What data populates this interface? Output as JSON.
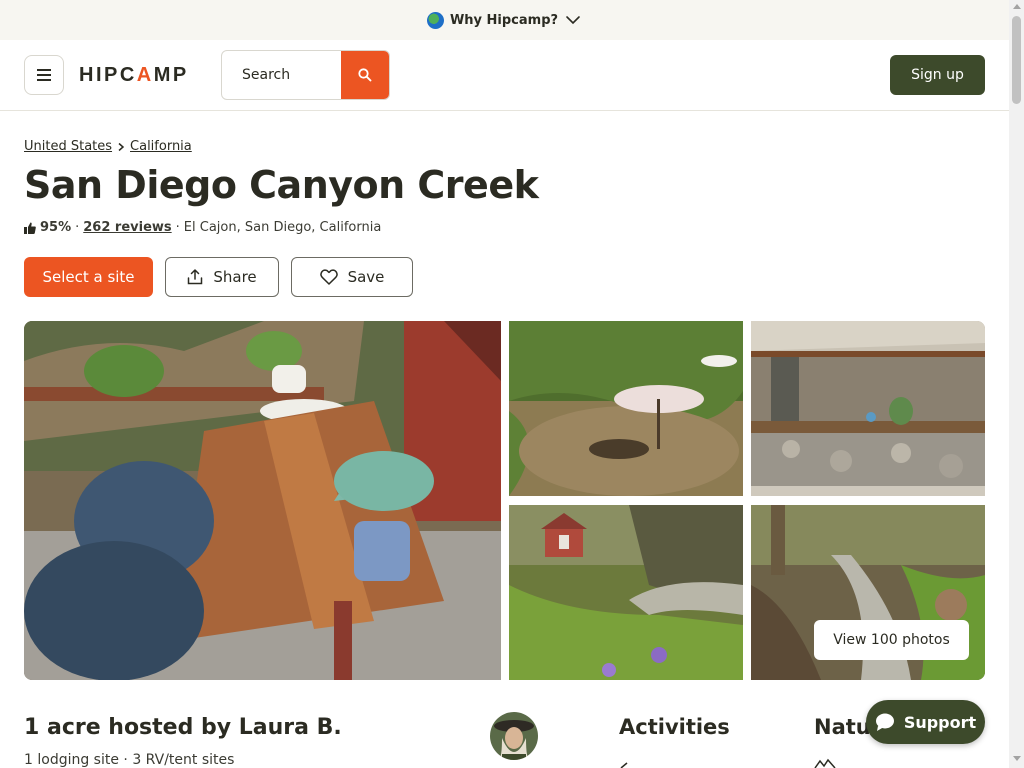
{
  "banner": {
    "label": "Why Hipcamp?"
  },
  "header": {
    "logo": {
      "prefix": "HIPC",
      "accent": "A",
      "suffix": "MP"
    },
    "search_label": "Search",
    "signup_label": "Sign up"
  },
  "breadcrumb": [
    "United States",
    "California"
  ],
  "listing": {
    "title": "San Diego Canyon Creek",
    "rating_pct": "95%",
    "separator": "·",
    "reviews_label": "262 reviews",
    "location": "El Cajon, San Diego, California"
  },
  "actions": {
    "select_label": "Select a site",
    "share_label": "Share",
    "save_label": "Save"
  },
  "gallery": {
    "view_photos_label": "View 100 photos"
  },
  "host": {
    "heading": "1 acre hosted by Laura B.",
    "subtitle": "1 lodging site · 3 RV/tent sites"
  },
  "sections": {
    "activities": "Activities",
    "nature": "Natur"
  },
  "support_label": "Support",
  "colors": {
    "accent": "#ec5522",
    "brand_dark": "#3d4a2b",
    "banner_bg": "#f7f6f1"
  },
  "icons": [
    "globe-icon",
    "chevron-down-icon",
    "menu-icon",
    "search-icon",
    "thumbs-up-icon",
    "chevron-right-icon",
    "share-icon",
    "heart-icon",
    "chat-icon"
  ]
}
